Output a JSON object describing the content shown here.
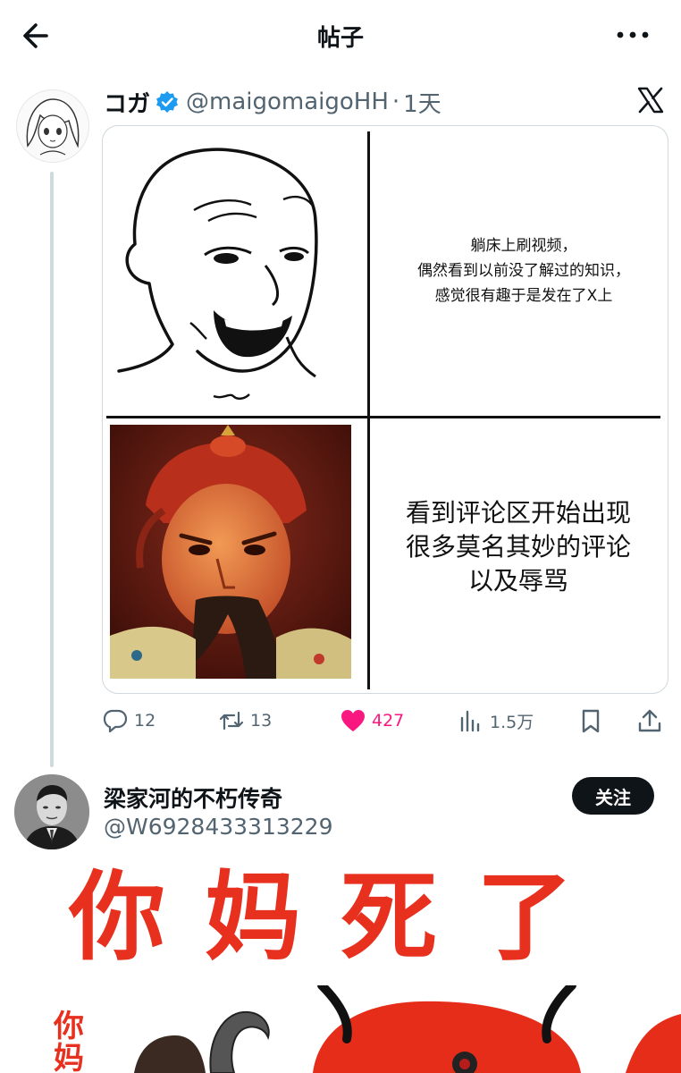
{
  "header": {
    "title": "帖子"
  },
  "quoted_tweet": {
    "author_name": "コガ",
    "handle": "@maigomaigoHH",
    "separator": "·",
    "time": "1天",
    "panel_top_text": "躺床上刷视频，\n偶然看到以前没了解过的知识，\n感觉很有趣于是发在了X上",
    "panel_bottom_text": "看到评论区开始出现\n很多莫名其妙的评论\n以及辱骂",
    "actions": {
      "replies": "12",
      "reposts": "13",
      "likes": "427",
      "views": "1.5万"
    },
    "like_color": "#f91880",
    "verified_color": "#1d9bf0"
  },
  "reply": {
    "author_name": "梁家河的不朽传奇",
    "handle": "@W6928433313229",
    "follow_label": "关注",
    "image_text": "你妈死了",
    "image_side_text": "你\n妈",
    "text_color": "#e8301f"
  }
}
